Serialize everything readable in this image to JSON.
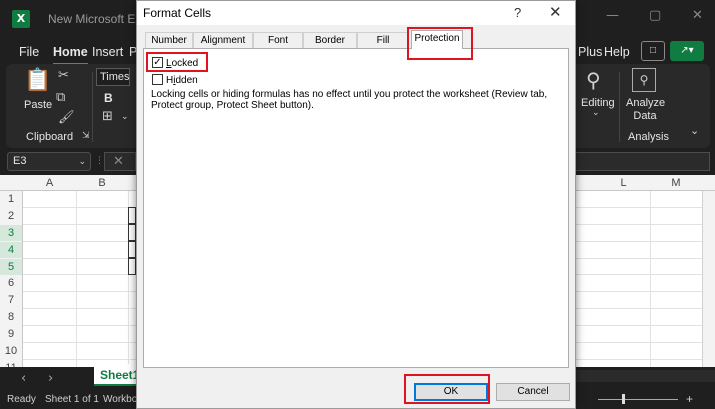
{
  "excel": {
    "logo": "X",
    "title": "New Microsoft Excel",
    "window_controls": {
      "minimize": "—",
      "maximize": "▢",
      "close": "✕"
    },
    "menu": {
      "file": "File",
      "home": "Home",
      "insert": "Insert",
      "p": "P",
      "plus": "Plus",
      "help": "Help"
    },
    "ribbon": {
      "paste": "Paste",
      "clipboard": "Clipboard",
      "font_name": "Times N",
      "bold": "B",
      "editing": "Editing",
      "analyze_data": "Analyze Data",
      "analysis": "Analysis"
    },
    "name_box": "E3",
    "columns_left": [
      "A",
      "B"
    ],
    "columns_right": [
      "L",
      "M"
    ],
    "rows": [
      "1",
      "2",
      "3",
      "4",
      "5",
      "6",
      "7",
      "8",
      "9",
      "10",
      "11"
    ],
    "selected_rows": [
      "3",
      "4",
      "5"
    ],
    "sheet_tab": "Sheet1",
    "status": {
      "ready": "Ready",
      "sheet_info": "Sheet 1 of 1",
      "workbook": "Workbo"
    }
  },
  "dialog": {
    "title": "Format Cells",
    "help": "?",
    "close": "✕",
    "tabs": [
      "Number",
      "Alignment",
      "Font",
      "Border",
      "Fill",
      "Protection"
    ],
    "active_tab": "Protection",
    "locked": {
      "pre": "",
      "ul": "L",
      "post": "ocked",
      "checked": true
    },
    "hidden": {
      "pre": "H",
      "ul": "i",
      "post": "dden",
      "checked": false
    },
    "note": "Locking cells or hiding formulas has no effect until you protect the worksheet (Review tab, Protect group, Protect Sheet button).",
    "ok": "OK",
    "cancel": "Cancel"
  },
  "colors": {
    "accent": "#107c41",
    "annotation": "#e0141e",
    "focus": "#0078d7"
  }
}
